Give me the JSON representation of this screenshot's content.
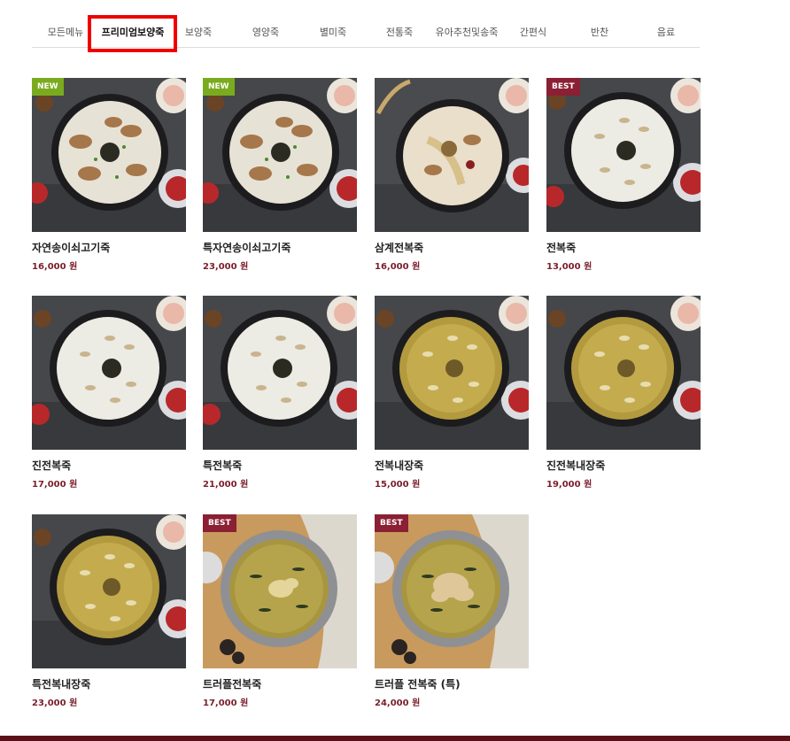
{
  "category_tabs": [
    {
      "label": "모든메뉴",
      "active": false
    },
    {
      "label": "프리미엄보양죽",
      "active": true
    },
    {
      "label": "보양죽",
      "active": false
    },
    {
      "label": "영양죽",
      "active": false
    },
    {
      "label": "별미죽",
      "active": false
    },
    {
      "label": "전통죽",
      "active": false
    },
    {
      "label": "유아추천및송죽",
      "active": false
    },
    {
      "label": "간편식",
      "active": false
    },
    {
      "label": "반찬",
      "active": false
    },
    {
      "label": "음료",
      "active": false
    }
  ],
  "badge_colors": {
    "NEW": "#7aab1e",
    "BEST": "#8b1f33"
  },
  "products": [
    {
      "name": "자연송이쇠고기죽",
      "price": "16,000 원",
      "badge": "NEW",
      "style": "white-mushroom"
    },
    {
      "name": "특자연송이쇠고기죽",
      "price": "23,000 원",
      "badge": "NEW",
      "style": "white-mushroom"
    },
    {
      "name": "삼계전복죽",
      "price": "16,000 원",
      "badge": "",
      "style": "samgye"
    },
    {
      "name": "전복죽",
      "price": "13,000 원",
      "badge": "BEST",
      "style": "white"
    },
    {
      "name": "진전복죽",
      "price": "17,000 원",
      "badge": "",
      "style": "white"
    },
    {
      "name": "특전복죽",
      "price": "21,000 원",
      "badge": "",
      "style": "white"
    },
    {
      "name": "전복내장죽",
      "price": "15,000 원",
      "badge": "",
      "style": "yellow"
    },
    {
      "name": "진전복내장죽",
      "price": "19,000 원",
      "badge": "",
      "style": "yellow"
    },
    {
      "name": "특전복내장죽",
      "price": "23,000 원",
      "badge": "",
      "style": "yellow"
    },
    {
      "name": "트러플전복죽",
      "price": "17,000 원",
      "badge": "BEST",
      "style": "truffle"
    },
    {
      "name": "트러플 전복죽 (특)",
      "price": "24,000 원",
      "badge": "BEST",
      "style": "truffle"
    }
  ]
}
